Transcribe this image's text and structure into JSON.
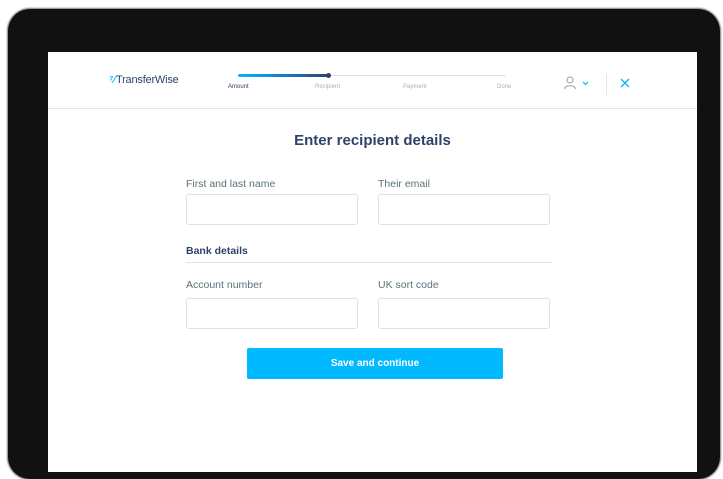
{
  "header": {
    "logo_mark": "⁷⁄",
    "logo_text": "TransferWise",
    "steps": [
      "Amount",
      "Recipient",
      "Payment",
      "Done"
    ]
  },
  "form": {
    "title": "Enter recipient details",
    "name_label": "First and last name",
    "name_value": "",
    "email_label": "Their email",
    "email_value": "",
    "bank_section": "Bank details",
    "account_label": "Account number",
    "account_value": "",
    "sort_label": "UK sort code",
    "sort_value": "",
    "submit": "Save and continue"
  },
  "progress": {
    "completed_fraction": 0.34
  },
  "colors": {
    "brand_navy": "#2e4369",
    "accent_blue": "#00b9ff",
    "border": "#dfe3e8",
    "label_gray": "#5d7079"
  },
  "icons": {
    "user": "user-icon",
    "chevron": "chevron-down-icon",
    "close": "close-icon"
  }
}
